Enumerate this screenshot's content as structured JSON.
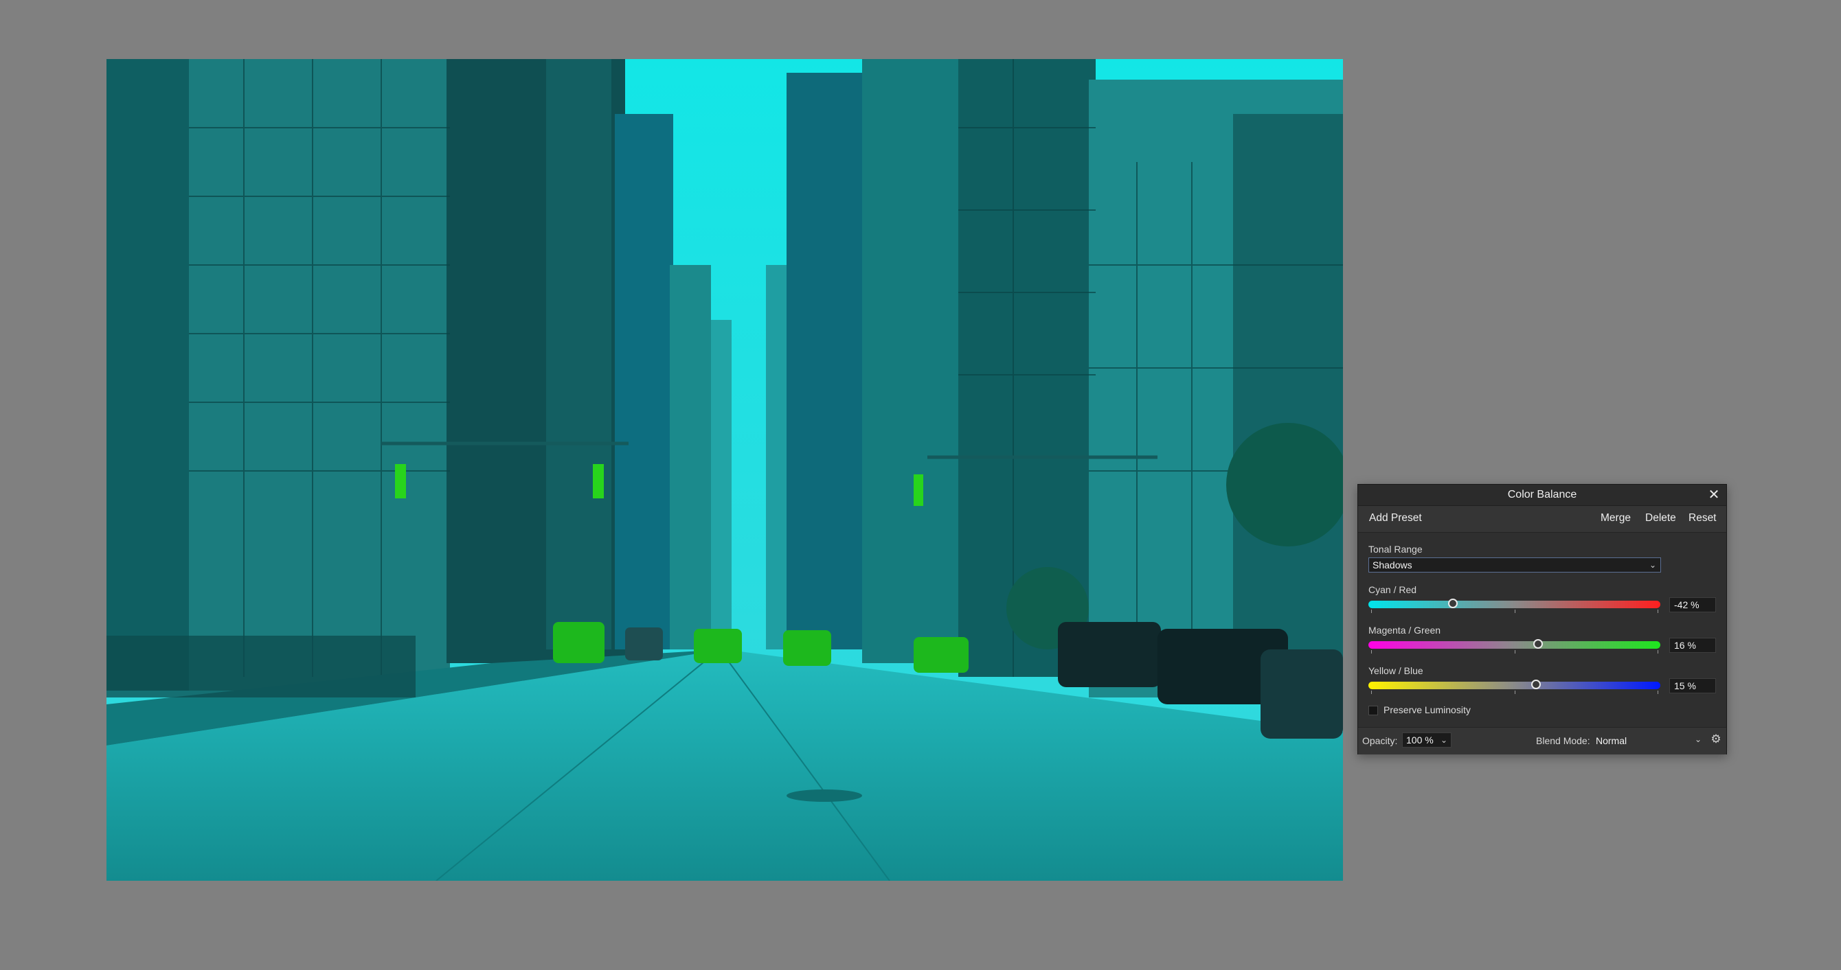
{
  "panel": {
    "title": "Color Balance",
    "close_glyph": "✕",
    "toolbar": {
      "add_preset": "Add Preset",
      "merge": "Merge",
      "delete": "Delete",
      "reset": "Reset"
    },
    "tonal_range": {
      "label": "Tonal Range",
      "value": "Shadows"
    },
    "sliders": [
      {
        "label": "Cyan / Red",
        "value_text": "-42 %",
        "value": -42,
        "min": -100,
        "max": 100,
        "gradient": [
          "#00e5ec",
          "#ff1f1f"
        ]
      },
      {
        "label": "Magenta / Green",
        "value_text": "16 %",
        "value": 16,
        "min": -100,
        "max": 100,
        "gradient": [
          "#ff00e6",
          "#1ee61e"
        ]
      },
      {
        "label": "Yellow / Blue",
        "value_text": "15 %",
        "value": 15,
        "min": -100,
        "max": 100,
        "gradient": [
          "#fff200",
          "#0019ff"
        ]
      }
    ],
    "preserve_luminosity": {
      "label": "Preserve Luminosity",
      "checked": false
    },
    "footer": {
      "opacity_label": "Opacity:",
      "opacity_value": "100 %",
      "blend_mode_label": "Blend Mode:",
      "blend_mode_value": "Normal"
    }
  },
  "icons": {
    "close": "close-icon",
    "chevron": "chevron-down-icon",
    "gear": "gear-icon"
  }
}
